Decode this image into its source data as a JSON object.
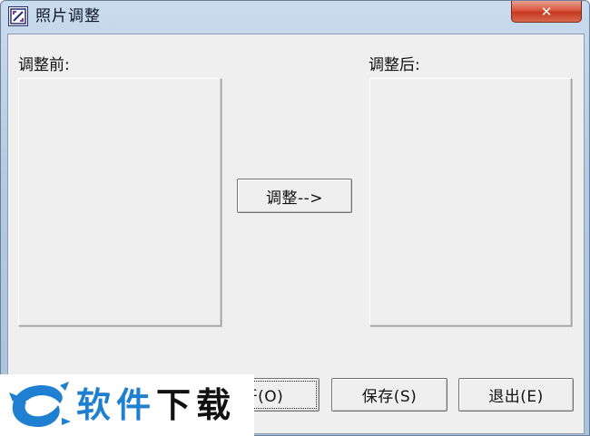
{
  "window": {
    "title": "照片调整",
    "close_glyph": "✕"
  },
  "labels": {
    "before": "调整前:",
    "after": "调整后:"
  },
  "buttons": {
    "adjust": "调整-->",
    "open": "开(O)",
    "save": "保存(S)",
    "exit": "退出(E)"
  },
  "watermark": {
    "text_blue": "软件",
    "text_black": "下载"
  },
  "icons": {
    "app": "photo-adjust-icon",
    "close": "close-icon",
    "watermark_logo": "dragon-logo"
  },
  "colors": {
    "titlebar": "#b5cbe3",
    "close_button": "#d9563d",
    "client_bg": "#efefef",
    "watermark_blue": "#1f7fd0"
  }
}
